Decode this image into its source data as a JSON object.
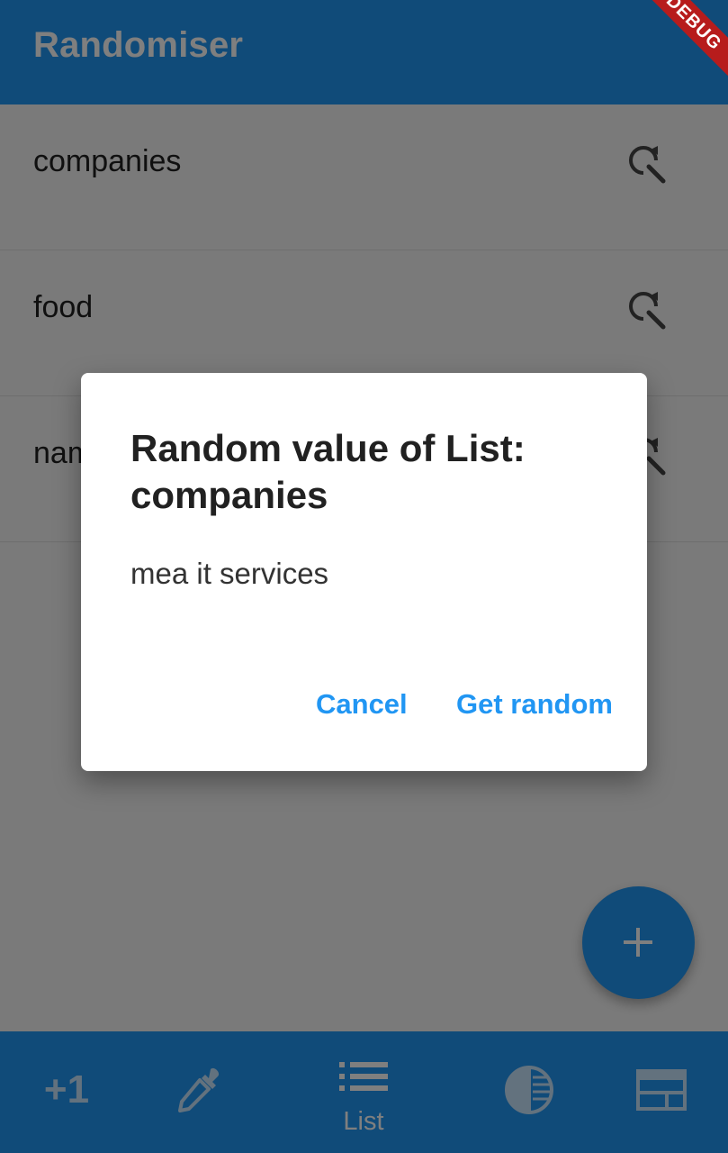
{
  "app": {
    "title": "Randomiser",
    "debug_banner": "DEBUG",
    "accent_color": "#2196f3"
  },
  "lists": [
    {
      "label": "companies",
      "icon": "search-refresh-icon"
    },
    {
      "label": "food",
      "icon": "search-refresh-icon"
    },
    {
      "label": "names",
      "icon": "search-refresh-icon"
    }
  ],
  "fab": {
    "icon": "add-icon"
  },
  "bottom_nav": {
    "items": [
      {
        "name": "plus-one",
        "text": "+1"
      },
      {
        "name": "colorize",
        "icon": "eyedropper-icon"
      },
      {
        "name": "list",
        "icon": "list-icon",
        "label": "List"
      },
      {
        "name": "contrast",
        "icon": "contrast-icon"
      },
      {
        "name": "panel",
        "icon": "panel-icon"
      }
    ]
  },
  "dialog": {
    "title": "Random value of List: companies",
    "value": "mea it services",
    "cancel_label": "Cancel",
    "get_random_label": "Get random"
  }
}
